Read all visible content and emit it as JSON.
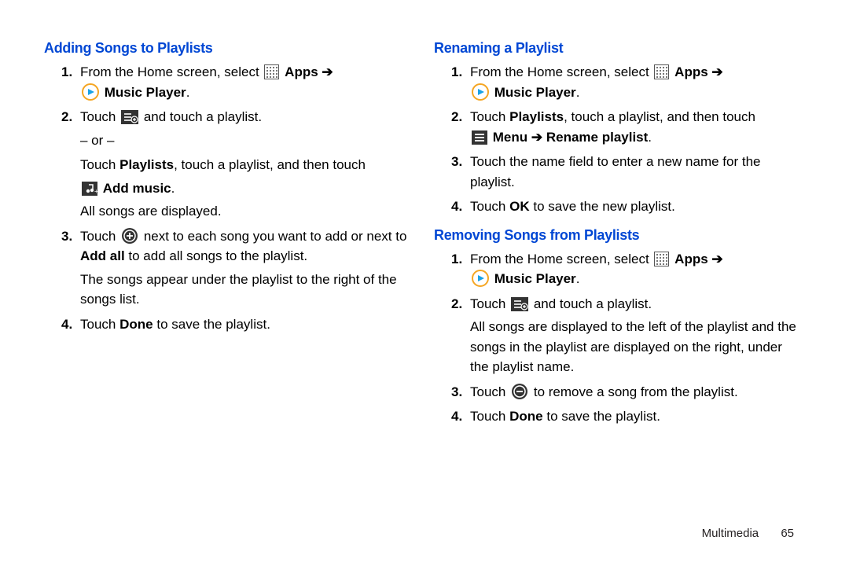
{
  "left": {
    "title": "Adding Songs to Playlists",
    "step1_a": "From the Home screen, select",
    "step1_apps": "Apps",
    "step1_music": "Music Player",
    "step2_a": "Touch",
    "step2_b": "and touch a playlist.",
    "step2_or": "– or –",
    "step2_line2a": "Touch",
    "step2_playlists": "Playlists",
    "step2_line2b": ", touch a playlist, and then touch",
    "step2_addmusic": "Add music",
    "step2_allsongs": "All songs are displayed.",
    "step3_a": "Touch",
    "step3_b": "next to each song you want to add or next to",
    "step3_addall": "Add all",
    "step3_c": "to add all songs to the playlist.",
    "step3_para": "The songs appear under the playlist to the right of the songs list.",
    "step4_a": "Touch",
    "step4_done": "Done",
    "step4_b": "to save the playlist."
  },
  "right_a": {
    "title": "Renaming a Playlist",
    "step1_a": "From the Home screen, select",
    "step1_apps": "Apps",
    "step1_music": "Music Player",
    "step2_a": "Touch",
    "step2_pl": "Playlists",
    "step2_b": ", touch a playlist, and then touch",
    "step2_menu": "Menu",
    "step2_ren": "Rename playlist",
    "step3": "Touch the name field to enter a new name for the playlist.",
    "step4_a": "Touch",
    "step4_ok": "OK",
    "step4_b": "to save the new playlist."
  },
  "right_b": {
    "title": "Removing Songs from Playlists",
    "step1_a": "From the Home screen, select",
    "step1_apps": "Apps",
    "step1_music": "Music Player",
    "step2_a": "Touch",
    "step2_b": "and touch a playlist.",
    "step2_para": "All songs are displayed to the left of the playlist and the songs in the playlist are displayed on the right, under the playlist name.",
    "step3_a": "Touch",
    "step3_b": "to remove a song from the playlist.",
    "step4_a": "Touch",
    "step4_done": "Done",
    "step4_b": "to save the playlist."
  },
  "footer": {
    "chapter": "Multimedia",
    "page": "65"
  }
}
